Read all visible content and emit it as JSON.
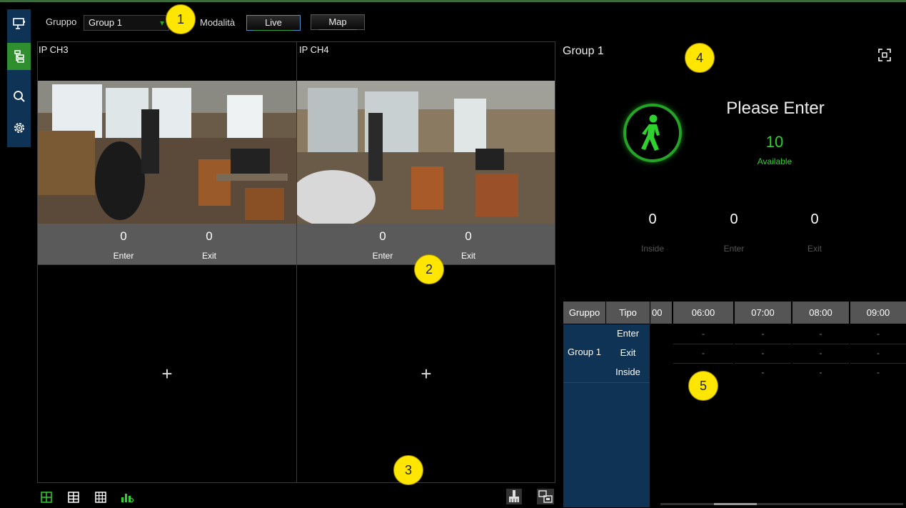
{
  "topbar": {
    "group_label": "Gruppo",
    "group_value": "Group 1",
    "mode_label": "Modalità",
    "modes": [
      "Live",
      "Map"
    ],
    "active_mode": "Live"
  },
  "sidebar": {
    "items": [
      {
        "icon": "monitor-icon",
        "active": false
      },
      {
        "icon": "people-count-icon",
        "active": true
      },
      {
        "icon": "search-icon",
        "active": false
      },
      {
        "icon": "settings-icon",
        "active": false
      }
    ]
  },
  "channels": [
    {
      "name": "IP CH3",
      "enter_count": "0",
      "exit_count": "0",
      "enter_label": "Enter",
      "exit_label": "Exit"
    },
    {
      "name": "IP CH4",
      "enter_count": "0",
      "exit_count": "0",
      "enter_label": "Enter",
      "exit_label": "Exit"
    }
  ],
  "empty_slot_symbol": "+",
  "bottom_toolbar": {
    "layouts": [
      "layout-4-icon",
      "layout-6-icon",
      "layout-9-icon",
      "stats-icon"
    ],
    "actions": [
      "clear-icon",
      "switch-icon"
    ]
  },
  "summary": {
    "group_title": "Group 1",
    "status_text": "Please Enter",
    "available_count": "10",
    "available_label": "Available",
    "inside_count": "0",
    "enter_count": "0",
    "exit_count": "0",
    "inside_label": "Inside",
    "enter_label": "Enter",
    "exit_label": "Exit"
  },
  "table": {
    "group_header": "Gruppo",
    "type_header": "Tipo",
    "time_headers": [
      "00",
      "06:00",
      "07:00",
      "08:00",
      "09:00"
    ],
    "group_name": "Group 1",
    "rows": [
      {
        "type": "Enter",
        "values": [
          "",
          "-",
          "-",
          "-",
          "-"
        ]
      },
      {
        "type": "Exit",
        "values": [
          "",
          "-",
          "-",
          "-",
          "-"
        ]
      },
      {
        "type": "Inside",
        "values": [
          "",
          "-",
          "-",
          "-",
          "-"
        ]
      }
    ]
  },
  "annotations": [
    "1",
    "2",
    "3",
    "4",
    "5"
  ],
  "colors": {
    "accent_green": "#2fd12f",
    "sidebar_bg": "#0f3354",
    "table_group_bg": "#0f3354",
    "badge_yellow": "#ffe600"
  }
}
